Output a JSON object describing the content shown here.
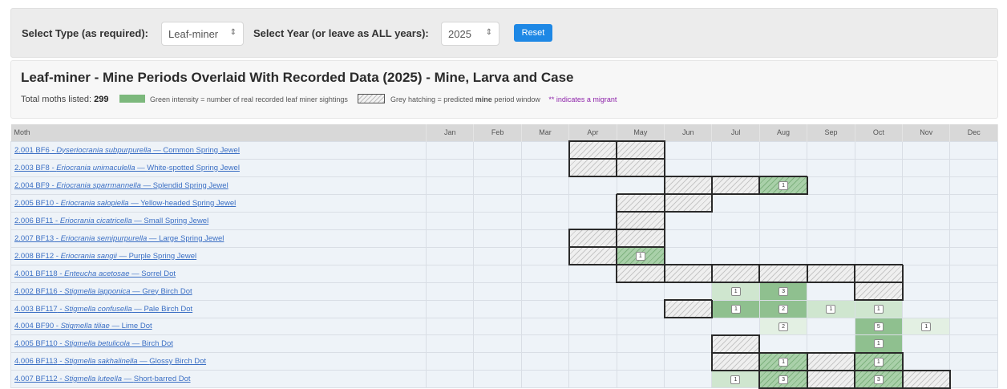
{
  "filters": {
    "type_label": "Select Type (as required):",
    "type_value": "Leaf-miner",
    "year_label": "Select Year (or leave as ALL years):",
    "year_value": "2025",
    "reset_label": "Reset"
  },
  "info": {
    "title": "Leaf-miner - Mine Periods Overlaid With Recorded Data (2025) - Mine, Larva and Case",
    "total_label": "Total moths listed:",
    "total_count": "299",
    "legend_green": "Green intensity = number of real recorded leaf miner sightings",
    "legend_grey_pre": "Grey hatching = predicted",
    "legend_grey_bold": "mine",
    "legend_grey_post": "period window",
    "legend_migrant": "** indicates a migrant"
  },
  "table": {
    "moth_header": "Moth",
    "months": [
      "Jan",
      "Feb",
      "Mar",
      "Apr",
      "May",
      "Jun",
      "Jul",
      "Aug",
      "Sep",
      "Oct",
      "Nov",
      "Dec"
    ],
    "rows": [
      {
        "code": "2.001 BF6",
        "latin": "Dyseriocrania subpurpurella",
        "common": "Common Spring Jewel",
        "cells": [
          "",
          "",
          "",
          "h",
          "h",
          "",
          "",
          "",
          "",
          "",
          "",
          ""
        ],
        "counts": [
          "",
          "",
          "",
          "",
          "",
          "",
          "",
          "",
          "",
          "",
          "",
          ""
        ]
      },
      {
        "code": "2.003 BF8",
        "latin": "Eriocrania unimaculella",
        "common": "White-spotted Spring Jewel",
        "cells": [
          "",
          "",
          "",
          "h",
          "h",
          "",
          "",
          "",
          "",
          "",
          "",
          ""
        ],
        "counts": [
          "",
          "",
          "",
          "",
          "",
          "",
          "",
          "",
          "",
          "",
          "",
          ""
        ]
      },
      {
        "code": "2.004 BF9",
        "latin": "Eriocrania sparrmannella",
        "common": "Splendid Spring Jewel",
        "cells": [
          "",
          "",
          "",
          "",
          "",
          "h",
          "h",
          "gh",
          "",
          "",
          "",
          ""
        ],
        "counts": [
          "",
          "",
          "",
          "",
          "",
          "",
          "",
          "1",
          "",
          "",
          "",
          ""
        ]
      },
      {
        "code": "2.005 BF10",
        "latin": "Eriocrania salopiella",
        "common": "Yellow-headed Spring Jewel",
        "cells": [
          "",
          "",
          "",
          "",
          "h",
          "h",
          "",
          "",
          "",
          "",
          "",
          ""
        ],
        "counts": [
          "",
          "",
          "",
          "",
          "",
          "",
          "",
          "",
          "",
          "",
          "",
          ""
        ]
      },
      {
        "code": "2.006 BF11",
        "latin": "Eriocrania cicatricella",
        "common": "Small Spring Jewel",
        "cells": [
          "",
          "",
          "",
          "",
          "h",
          "",
          "",
          "",
          "",
          "",
          "",
          ""
        ],
        "counts": [
          "",
          "",
          "",
          "",
          "",
          "",
          "",
          "",
          "",
          "",
          "",
          ""
        ]
      },
      {
        "code": "2.007 BF13",
        "latin": "Eriocrania semipurpurella",
        "common": "Large Spring Jewel",
        "cells": [
          "",
          "",
          "",
          "h",
          "h",
          "",
          "",
          "",
          "",
          "",
          "",
          ""
        ],
        "counts": [
          "",
          "",
          "",
          "",
          "",
          "",
          "",
          "",
          "",
          "",
          "",
          ""
        ]
      },
      {
        "code": "2.008 BF12",
        "latin": "Eriocrania sangii",
        "common": "Purple Spring Jewel",
        "cells": [
          "",
          "",
          "",
          "h",
          "gh",
          "",
          "",
          "",
          "",
          "",
          "",
          ""
        ],
        "counts": [
          "",
          "",
          "",
          "",
          "1",
          "",
          "",
          "",
          "",
          "",
          "",
          ""
        ]
      },
      {
        "code": "4.001 BF118",
        "latin": "Enteucha acetosae",
        "common": "Sorrel Dot",
        "cells": [
          "",
          "",
          "",
          "",
          "h",
          "h",
          "h",
          "h",
          "h",
          "h",
          "",
          ""
        ],
        "counts": [
          "",
          "",
          "",
          "",
          "",
          "",
          "",
          "",
          "",
          "",
          "",
          ""
        ]
      },
      {
        "code": "4.002 BF116",
        "latin": "Stigmella lapponica",
        "common": "Grey Birch Dot",
        "cells": [
          "",
          "",
          "",
          "",
          "",
          "",
          "g2",
          "g1",
          "",
          "h",
          "",
          ""
        ],
        "counts": [
          "",
          "",
          "",
          "",
          "",
          "",
          "1",
          "3",
          "",
          "",
          "",
          ""
        ]
      },
      {
        "code": "4.003 BF117",
        "latin": "Stigmella confusella",
        "common": "Pale Birch Dot",
        "cells": [
          "",
          "",
          "",
          "",
          "",
          "h",
          "g1",
          "g1",
          "g2",
          "g2",
          "",
          ""
        ],
        "counts": [
          "",
          "",
          "",
          "",
          "",
          "",
          "1",
          "2",
          "1",
          "1",
          "",
          ""
        ]
      },
      {
        "code": "4.004 BF90",
        "latin": "Stigmella tiliae",
        "common": "Lime Dot",
        "cells": [
          "",
          "",
          "",
          "",
          "",
          "",
          "",
          "g3",
          "",
          "g1",
          "g3",
          ""
        ],
        "counts": [
          "",
          "",
          "",
          "",
          "",
          "",
          "",
          "2",
          "",
          "5",
          "1",
          ""
        ]
      },
      {
        "code": "4.005 BF110",
        "latin": "Stigmella betulicola",
        "common": "Birch Dot",
        "cells": [
          "",
          "",
          "",
          "",
          "",
          "",
          "h",
          "",
          "",
          "g1",
          "",
          ""
        ],
        "counts": [
          "",
          "",
          "",
          "",
          "",
          "",
          "",
          "",
          "",
          "1",
          "",
          ""
        ]
      },
      {
        "code": "4.006 BF113",
        "latin": "Stigmella sakhalinella",
        "common": "Glossy Birch Dot",
        "cells": [
          "",
          "",
          "",
          "",
          "",
          "",
          "h",
          "gh",
          "h",
          "gh",
          "",
          ""
        ],
        "counts": [
          "",
          "",
          "",
          "",
          "",
          "",
          "",
          "1",
          "",
          "1",
          "",
          ""
        ]
      },
      {
        "code": "4.007 BF112",
        "latin": "Stigmella luteella",
        "common": "Short-barred Dot",
        "cells": [
          "",
          "",
          "",
          "",
          "",
          "",
          "g2",
          "gh",
          "h",
          "gh",
          "h",
          ""
        ],
        "counts": [
          "",
          "",
          "",
          "",
          "",
          "",
          "1",
          "3",
          "",
          "3",
          "",
          ""
        ]
      }
    ]
  },
  "colors": {
    "reset_button": "#1e88e5",
    "green_strong": "#8fc08f",
    "green_light": "#cfe6cf",
    "link": "#3b6fc4",
    "migrant": "#8e24aa"
  },
  "icons": [
    "chevron-updown-icon"
  ]
}
